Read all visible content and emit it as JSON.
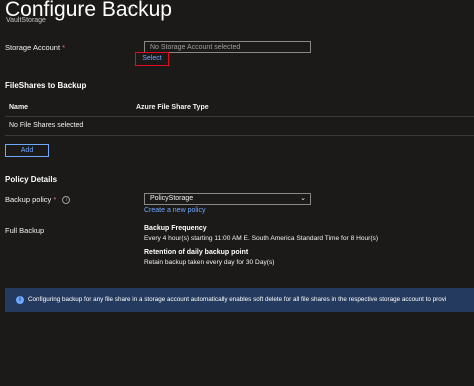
{
  "header": {
    "title": "Configure Backup",
    "more_label": "···",
    "subtitle": "VaultStorage"
  },
  "storage_account": {
    "label": "Storage Account",
    "required_marker": "*",
    "placeholder": "No Storage Account selected",
    "select_label": "Select"
  },
  "fileshares": {
    "heading": "FileShares to Backup",
    "columns": [
      "Name",
      "Azure File Share Type"
    ],
    "empty_text": "No File Shares selected",
    "add_label": "Add"
  },
  "policy": {
    "heading": "Policy Details",
    "backup_policy_label": "Backup policy",
    "required_marker": "*",
    "info_glyph": "i",
    "selected_policy": "PolicyStorage",
    "create_link": "Create a new policy",
    "full_backup_label": "Full Backup",
    "frequency_title": "Backup Frequency",
    "frequency_text": "Every 4 hour(s) starting 11:00 AM E. South America Standard Time for 8 Hour(s)",
    "retention_title": "Retention of daily backup point",
    "retention_text": "Retain backup taken every day for 30 Day(s)"
  },
  "banner": {
    "icon_glyph": "i",
    "text": "Configuring backup for any file share in a storage account automatically enables soft delete for all file shares in the respective storage account to provi"
  },
  "colors": {
    "background": "#1b1a19",
    "link": "#6ea8ff",
    "highlight_box": "#e00b1c",
    "banner_bg": "#243a5e",
    "required": "#f1707b"
  }
}
